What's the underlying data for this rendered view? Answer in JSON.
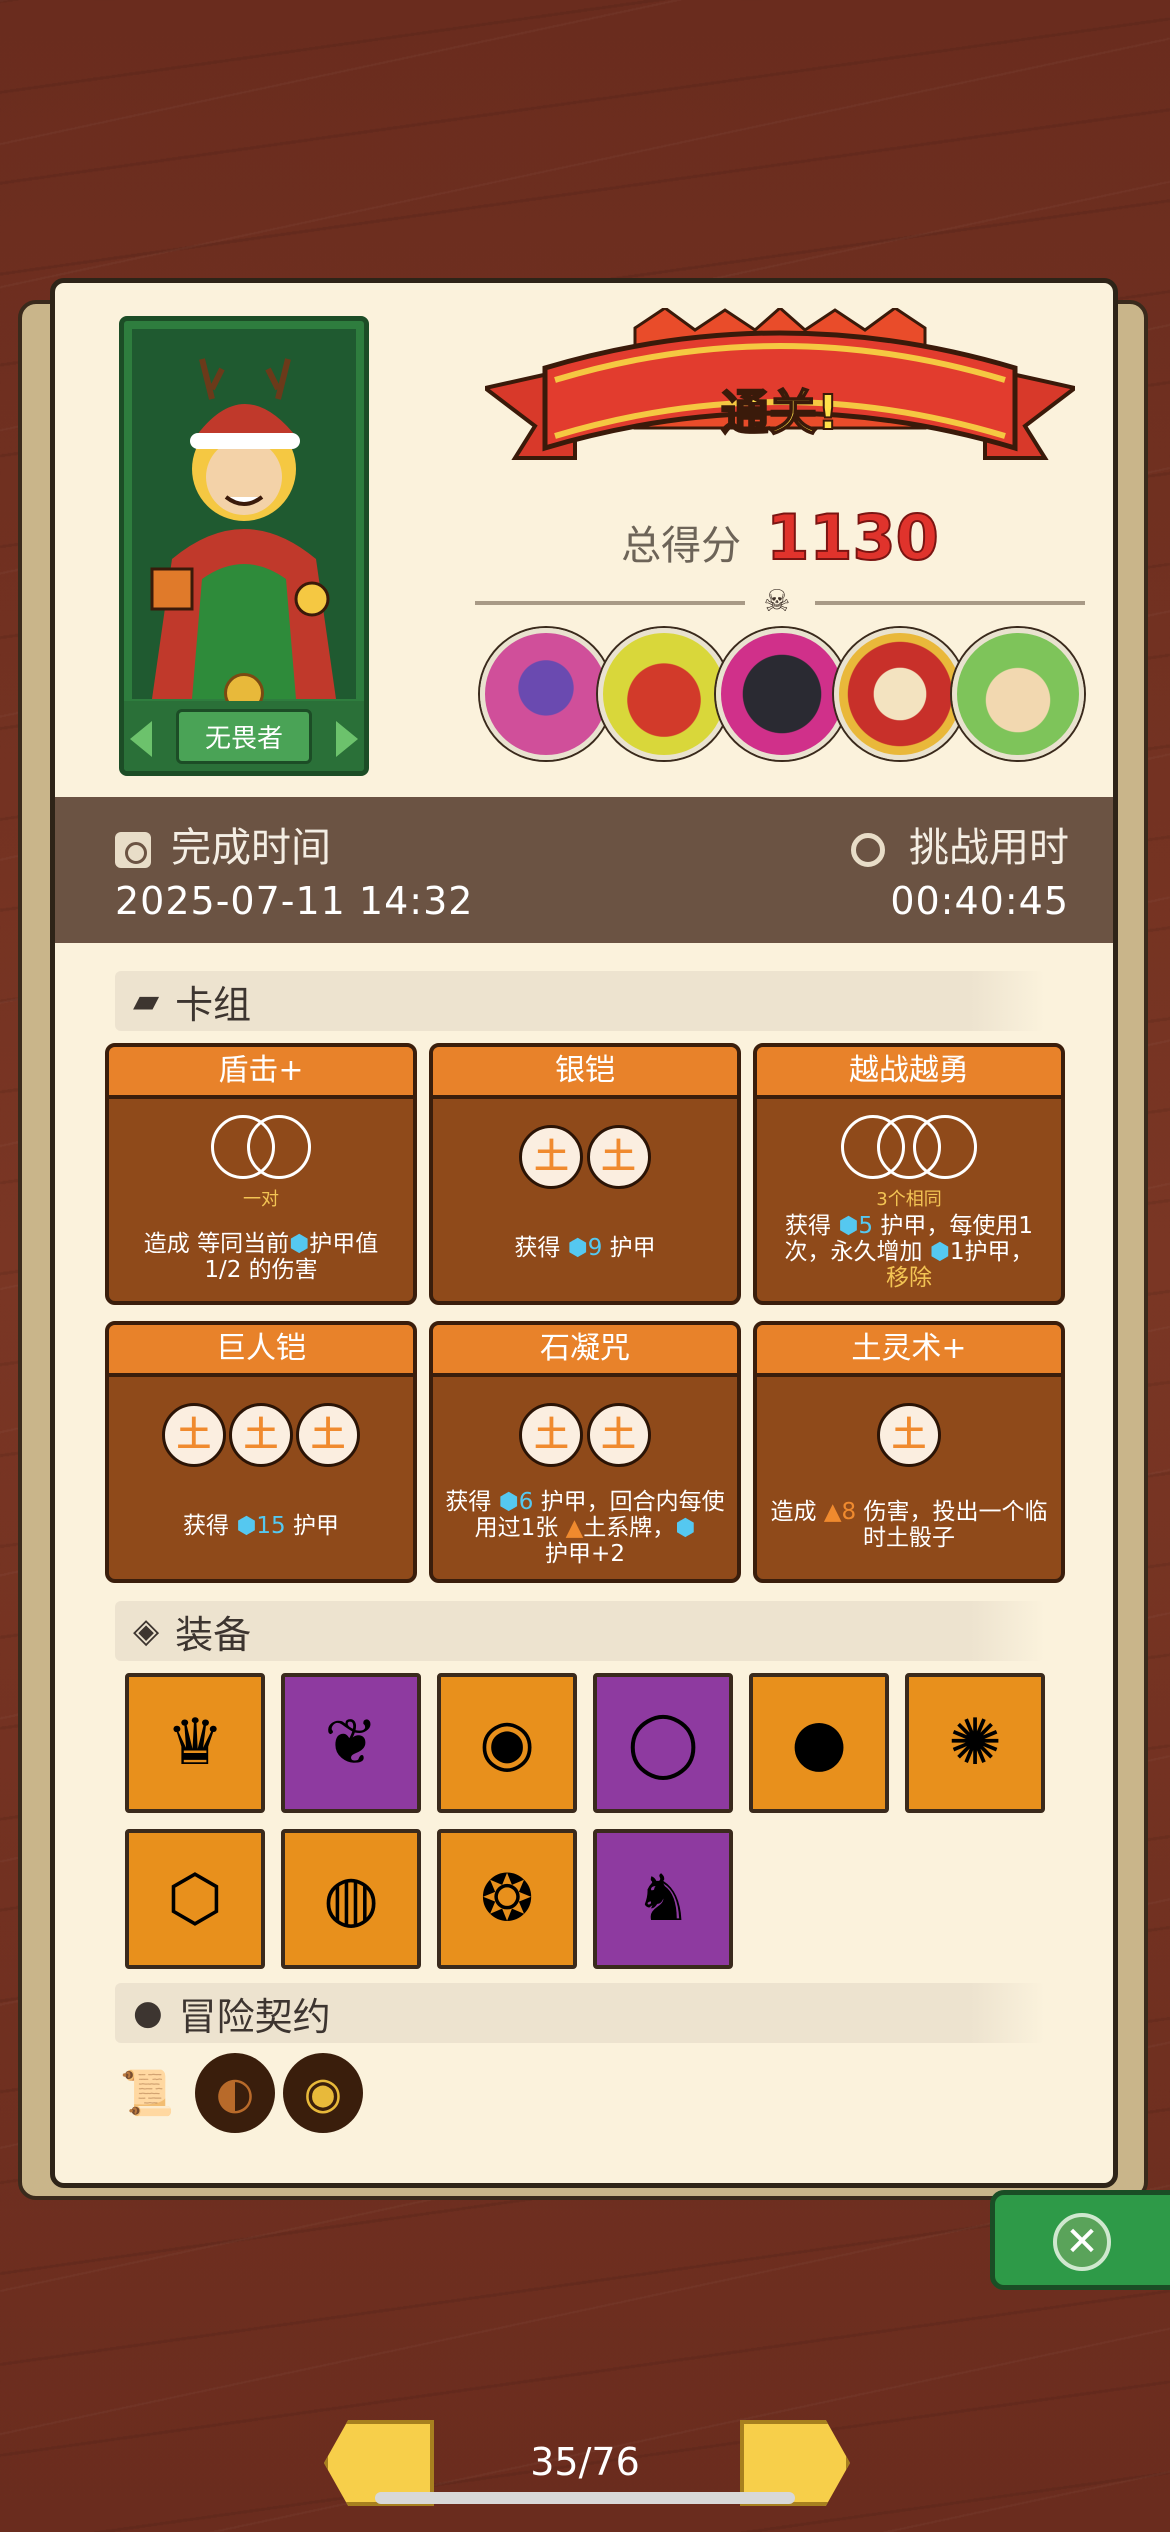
{
  "hero": {
    "name": "无畏者"
  },
  "result": {
    "banner": "通关!",
    "score_label": "总得分",
    "score": "1130"
  },
  "time": {
    "finish_label": "完成时间",
    "finish_value": "2025-07-11 14:32",
    "challenge_label": "挑战用时",
    "challenge_value": "00:40:45"
  },
  "sections": {
    "deck": "卡组",
    "equipment": "装备",
    "contracts": "冒险契约"
  },
  "cards": [
    {
      "title": "盾击+",
      "cost_note": "一对"
    },
    {
      "title": "银铠"
    },
    {
      "title": "越战越勇",
      "cost_note": "3个相同"
    },
    {
      "title": "巨人铠"
    },
    {
      "title": "石凝咒"
    },
    {
      "title": "土灵术+"
    }
  ],
  "card_text": {
    "c0_a": "造成 等同当前",
    "c0_b": "护甲值",
    "c0_c": "1/2 的伤害",
    "c1_a": "获得 ",
    "c1_n": "9",
    "c1_b": " 护甲",
    "c2_a": "获得 ",
    "c2_n": "5",
    "c2_b": " 护甲，每使用1次，永久增加 ",
    "c2_n2": "1",
    "c2_c": "护甲，",
    "c2_d": "移除",
    "c3_a": "获得 ",
    "c3_n": "15",
    "c3_b": " 护甲",
    "c4_a": "获得 ",
    "c4_n": "6",
    "c4_b": " 护甲，回合内每使用过1张 ",
    "c4_c": "土系牌，",
    "c4_d": "护甲+2",
    "c5_a": "造成 ",
    "c5_n": "8",
    "c5_b": " 伤害，投出一个临时土骰子"
  },
  "cost_glyph": "土",
  "equipment_icons": [
    "crown-icon",
    "dragon-horn-icon",
    "shield-icon",
    "mirror-icon",
    "ham-icon",
    "tribal-mask-icon",
    "crystal-skull-icon",
    "ring-icon",
    "mushroom-icon",
    "horned-helmet-icon"
  ],
  "pager": {
    "text": "35/76"
  },
  "colors": {
    "accent_red": "#e0332c",
    "card_orange": "#e8822a",
    "equip_orange": "#e8901c",
    "equip_purple": "#8e3aa0",
    "close_green": "#2e9a48"
  }
}
